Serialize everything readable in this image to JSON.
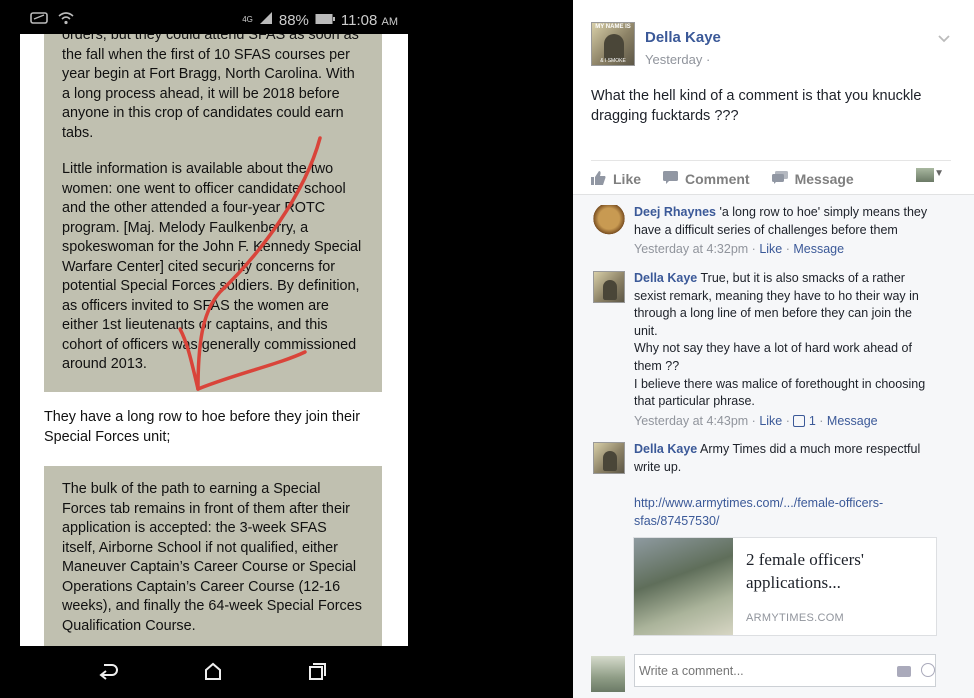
{
  "phone": {
    "status": {
      "network": "4G",
      "battery": "88%",
      "time": "11:08",
      "ampm": "AM"
    },
    "quote1": {
      "p1": "orders, but they could attend SFAS as soon as the fall when the first of 10 SFAS courses per year begin at Fort Bragg, North Carolina. With a long process ahead, it will be 2018 before anyone in this crop of candidates could earn tabs.",
      "p2": "Little information is available about the two women: one went to officer candidate school and the other attended a four-year ROTC program. [Maj. Melody Faulkenberry, a spokeswoman for the John F. Kennedy Special Warfare Center] cited security concerns for potential Special Forces soldiers. By definition, as officers invited to SFAS the women are either 1st lieutenants or captains, and this cohort of officers was generally commissioned around 2013."
    },
    "plain": "They have a long row to hoe before they join their Special Forces unit;",
    "quote2": "The bulk of the path to earning a Special Forces tab remains in front of them after their application is accepted: the 3-week SFAS itself, Airborne School if not qualified, either Maneuver Captain’s Career Course or Special Operations Captain’s Career Course (12-16 weeks), and finally the 64-week Special Forces Qualification Course.",
    "nav": {
      "back": "back-icon",
      "home": "home-icon",
      "recents": "recents-icon"
    },
    "annotation_color": "#d9443a"
  },
  "post": {
    "avatar_text_top": "MY NAME IS",
    "avatar_text_bottom": "& I SMOKE",
    "author": "Della Kaye",
    "time": "Yesterday ·",
    "text": "What the hell kind of a comment is that you knuckle dragging fucktards ???",
    "actions": {
      "like": "Like",
      "comment": "Comment",
      "message": "Message"
    }
  },
  "comments": [
    {
      "author": "Deej Rhaynes",
      "text": "'a long row to hoe' simply means they have a difficult series of challenges before them",
      "time": "Yesterday at 4:32pm",
      "like": "Like",
      "message": "Message"
    },
    {
      "author": "Della Kaye",
      "text": "True, but it is also smacks of a rather sexist remark, meaning they have to ho their way in through a long line of men before they can join the unit.",
      "text2": "Why not say they have a lot of hard work ahead of them ??",
      "text3": "I believe there was malice of forethought in choosing that particular phrase.",
      "time": "Yesterday at 4:43pm",
      "like": "Like",
      "likes": "1",
      "message": "Message"
    },
    {
      "author": "Della Kaye",
      "text": "Army Times did a much more respectful write up.",
      "url": "http://www.armytimes.com/.../female-officers-sfas/87457530/",
      "card_title": "2 female officers' applications...",
      "card_source": "ARMYTIMES.COM"
    }
  ],
  "composer": {
    "placeholder": "Write a comment..."
  },
  "colors": {
    "fb_blue": "#3b5998",
    "quote_bg": "#c0c0b0",
    "meta_gray": "#90949c"
  }
}
